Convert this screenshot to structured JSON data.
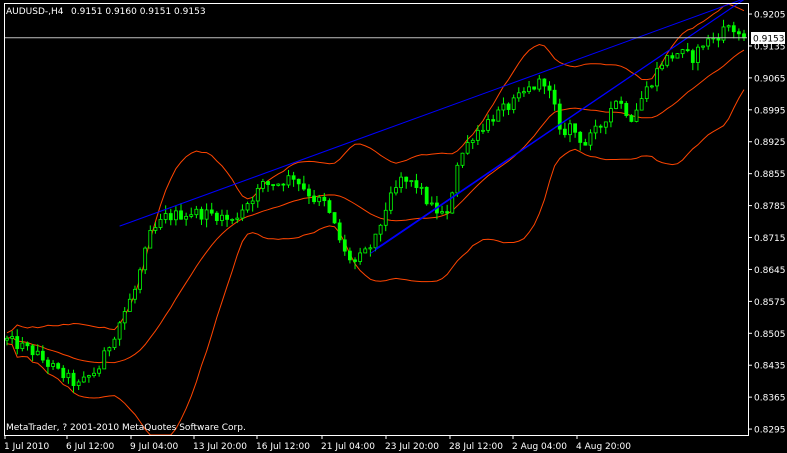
{
  "header": {
    "symbol_timeframe": "AUDUSD-,H4",
    "ohlc": "0.9151 0.9160 0.9151 0.9153"
  },
  "copyright": "MetaTrader, ? 2001-2010 MetaQuotes Software Corp.",
  "current_price_label": "0.9153",
  "colors": {
    "background": "#000000",
    "frame": "#ffffff",
    "candle": "#00ff00",
    "bollinger": "#ff4500",
    "channel": "#0000ff",
    "price_line": "#c0c0c0"
  },
  "chart_data": {
    "type": "candlestick",
    "instrument": "AUDUSD",
    "timeframe": "H4",
    "grid": false,
    "y_ticks": [
      "0.9205",
      "0.9135",
      "0.9065",
      "0.8995",
      "0.8925",
      "0.8855",
      "0.8785",
      "0.8715",
      "0.8645",
      "0.8575",
      "0.8505",
      "0.8435",
      "0.8365",
      "0.8295"
    ],
    "x_ticks": [
      "1 Jul 2010",
      "6 Jul 12:00",
      "9 Jul 04:00",
      "13 Jul 20:00",
      "16 Jul 12:00",
      "21 Jul 04:00",
      "23 Jul 20:00",
      "28 Jul 12:00",
      "2 Aug 04:00",
      "4 Aug 20:00"
    ],
    "ylim": [
      0.8282,
      0.9227
    ],
    "bar_count": 145,
    "last_close": 0.9153,
    "close_path": [
      [
        0,
        0.849
      ],
      [
        5,
        0.8465
      ],
      [
        10,
        0.842
      ],
      [
        14,
        0.839
      ],
      [
        18,
        0.843
      ],
      [
        22,
        0.853
      ],
      [
        25,
        0.86
      ],
      [
        28,
        0.872
      ],
      [
        31,
        0.876
      ],
      [
        36,
        0.877
      ],
      [
        41,
        0.8765
      ],
      [
        44,
        0.875
      ],
      [
        46,
        0.878
      ],
      [
        50,
        0.883
      ],
      [
        53,
        0.8835
      ],
      [
        56,
        0.885
      ],
      [
        60,
        0.88
      ],
      [
        62,
        0.879
      ],
      [
        64,
        0.874
      ],
      [
        66,
        0.868
      ],
      [
        68,
        0.866
      ],
      [
        70,
        0.868
      ],
      [
        72,
        0.871
      ],
      [
        74,
        0.878
      ],
      [
        77,
        0.884
      ],
      [
        80,
        0.883
      ],
      [
        83,
        0.878
      ],
      [
        86,
        0.876
      ],
      [
        88,
        0.888
      ],
      [
        91,
        0.894
      ],
      [
        95,
        0.898
      ],
      [
        99,
        0.901
      ],
      [
        102,
        0.904
      ],
      [
        105,
        0.906
      ],
      [
        107,
        0.9
      ],
      [
        108,
        0.894
      ],
      [
        110,
        0.896
      ],
      [
        113,
        0.892
      ],
      [
        116,
        0.896
      ],
      [
        119,
        0.902
      ],
      [
        122,
        0.898
      ],
      [
        125,
        0.904
      ],
      [
        128,
        0.91
      ],
      [
        131,
        0.912
      ],
      [
        134,
        0.911
      ],
      [
        136,
        0.914
      ],
      [
        139,
        0.916
      ],
      [
        141,
        0.918
      ],
      [
        144,
        0.9153
      ]
    ],
    "channel_lines": [
      {
        "name": "upper",
        "from": [
          22,
          0.874
        ],
        "to": [
          154,
          0.924
        ]
      },
      {
        "name": "lower",
        "from": [
          72,
          0.869
        ],
        "to": [
          166,
          0.924
        ]
      },
      {
        "name": "middle",
        "from": [
          71,
          0.868
        ],
        "to": [
          169,
          0.924
        ]
      }
    ],
    "bollinger": {
      "period": 20
    }
  }
}
